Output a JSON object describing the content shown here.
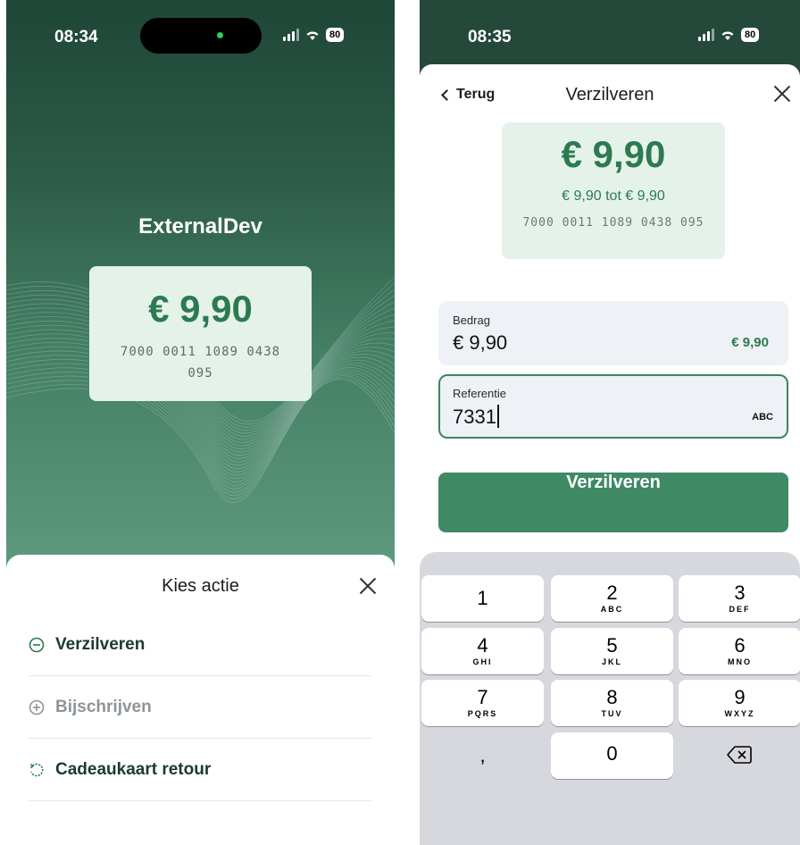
{
  "left": {
    "status": {
      "time": "08:34",
      "battery": "80"
    },
    "merchant_name": "ExternalDev",
    "card": {
      "amount": "€ 9,90",
      "number": "7000 0011 1089 0438 095"
    },
    "sheet": {
      "title": "Kies actie",
      "actions": [
        {
          "label": "Verzilveren",
          "icon": "minus-circle-icon",
          "enabled": true
        },
        {
          "label": "Bijschrijven",
          "icon": "plus-circle-icon",
          "enabled": false
        },
        {
          "label": "Cadeaukaart retour",
          "icon": "undo-icon",
          "enabled": true
        }
      ]
    }
  },
  "right": {
    "status": {
      "time": "08:35",
      "battery": "80"
    },
    "nav": {
      "back_label": "Terug",
      "title": "Verzilveren"
    },
    "card": {
      "amount": "€ 9,90",
      "range": "€ 9,90 tot € 9,90",
      "number": "7000 0011 1089 0438 095"
    },
    "amount_field": {
      "label": "Bedrag",
      "value": "€ 9,90",
      "hint": "€ 9,90"
    },
    "reference_field": {
      "label": "Referentie",
      "value": "7331",
      "hint": "ABC"
    },
    "submit_label": "Verzilveren",
    "keypad": [
      {
        "digit": "1",
        "letters": ""
      },
      {
        "digit": "2",
        "letters": "ABC"
      },
      {
        "digit": "3",
        "letters": "DEF"
      },
      {
        "digit": "4",
        "letters": "GHI"
      },
      {
        "digit": "5",
        "letters": "JKL"
      },
      {
        "digit": "6",
        "letters": "MNO"
      },
      {
        "digit": "7",
        "letters": "PQRS"
      },
      {
        "digit": "8",
        "letters": "TUV"
      },
      {
        "digit": "9",
        "letters": "WXYZ"
      },
      {
        "digit": ",",
        "letters": ""
      },
      {
        "digit": "0",
        "letters": ""
      }
    ]
  },
  "colors": {
    "brand_green": "#3f8965",
    "amount_green": "#2c7a51",
    "card_bg": "#e5f2ea"
  }
}
